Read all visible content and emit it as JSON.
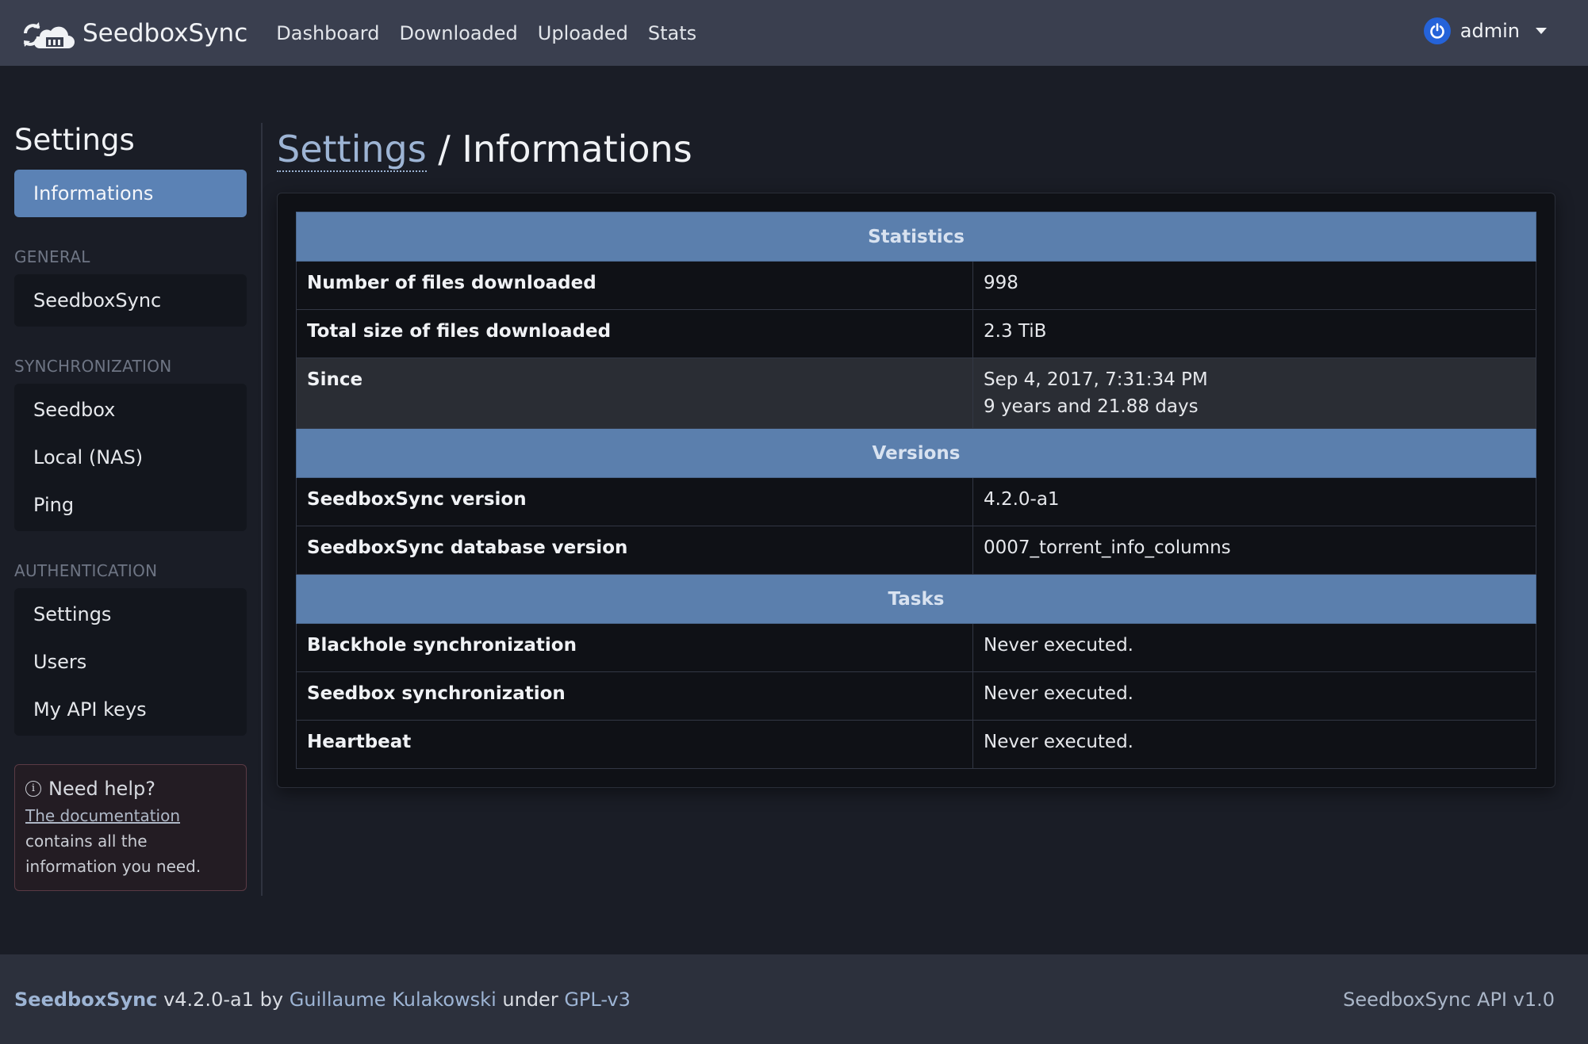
{
  "navbar": {
    "brand_name": "SeedboxSync",
    "links": [
      "Dashboard",
      "Downloaded",
      "Uploaded",
      "Stats"
    ],
    "user": "admin",
    "brand_icon": "cloud-sync-icon",
    "user_icon": "power-icon"
  },
  "sidebar": {
    "title": "Settings",
    "active_item": "Informations",
    "sections": [
      {
        "label": "GENERAL",
        "items": [
          "SeedboxSync"
        ]
      },
      {
        "label": "SYNCHRONIZATION",
        "items": [
          "Seedbox",
          "Local (NAS)",
          "Ping"
        ]
      },
      {
        "label": "AUTHENTICATION",
        "items": [
          "Settings",
          "Users",
          "My API keys"
        ]
      }
    ],
    "help": {
      "title": "Need help?",
      "link": "The documentation",
      "text": "contains all the information you need."
    }
  },
  "main": {
    "breadcrumb_link": "Settings",
    "breadcrumb_sep": "/",
    "breadcrumb_current": "Informations",
    "statistics": {
      "header": "Statistics",
      "rows": [
        {
          "label": "Number of files downloaded",
          "value": "998"
        },
        {
          "label": "Total size of files downloaded",
          "value": "2.3 TiB"
        },
        {
          "label": "Since",
          "value": "Sep 4, 2017, 7:31:34 PM",
          "value2": "9 years and 21.88 days"
        }
      ]
    },
    "versions": {
      "header": "Versions",
      "rows": [
        {
          "label": "SeedboxSync version",
          "value": "4.2.0-a1"
        },
        {
          "label": "SeedboxSync database version",
          "value": "0007_torrent_info_columns"
        }
      ]
    },
    "tasks": {
      "header": "Tasks",
      "rows": [
        {
          "label": "Blackhole synchronization",
          "value": "Never executed."
        },
        {
          "label": "Seedbox synchronization",
          "value": "Never executed."
        },
        {
          "label": "Heartbeat",
          "value": "Never executed."
        }
      ]
    }
  },
  "footer": {
    "brand": "SeedboxSync",
    "version": "v4.2.0-a1",
    "by": "by",
    "author": "Guillaume Kulakowski",
    "under": "under",
    "license": "GPL-v3",
    "api": "SeedboxSync API v1.0"
  },
  "colors": {
    "navbar_bg": "#3a3f4f",
    "page_bg": "#1a1d26",
    "accent": "#5b82b5",
    "table_header": "#5b7fad",
    "power_icon": "#2563d9"
  }
}
